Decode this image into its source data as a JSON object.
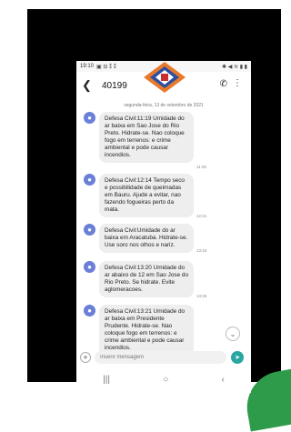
{
  "status_bar": {
    "time": "19:10",
    "left_icons": "▣ ⊟ ⁑ ⁑",
    "right_icons": "✱ ◀ ≋ ▮ ▮"
  },
  "header": {
    "contact_number": "40199",
    "back_icon": "arrow-back",
    "call_icon": "phone",
    "more_icon": "more-vertical"
  },
  "date_separator": "segunda-feira, 13 de setembro de 2021",
  "messages": [
    {
      "text": "Defesa Civil:11:19 Umidade do ar baixa em Sao Jose do Rio Preto. Hidrate-se. Nao coloque fogo em terrenos: e crime ambiental e pode causar incendios.",
      "time": "11:28"
    },
    {
      "text": "Defesa Civil:12:14 Tempo seco e possibilidade de queimadas em Bauru. Ajude a evitar, nao fazendo fogueiras perto da mata.",
      "time": "12:21"
    },
    {
      "text": "Defesa Civil:Umidade do ar baixa em Aracatuba. Hidrate-se. Use soro nos olhos e nariz.",
      "time": "13:16"
    },
    {
      "text": "Defesa Civil:13:20 Umidade do ar abaixo de 12 em Sao Jose do Rio Preto. Se hidrate. Evite aglomeracoes.",
      "time": "13:26"
    },
    {
      "text": "Defesa Civil:13:21 Umidade do ar baixa em Presidente Prudente. Hidrate-se. Nao coloque fogo em terrenos: e crime ambiental e pode causar incendios.",
      "time": ""
    }
  ],
  "composer": {
    "placeholder": "Inserir mensagem"
  },
  "colors": {
    "avatar": "#6a7fd8",
    "bubble": "#eeeeee",
    "send": "#2aa6a0",
    "logo_orange": "#e8792b",
    "logo_blue": "#2b4fa0"
  }
}
